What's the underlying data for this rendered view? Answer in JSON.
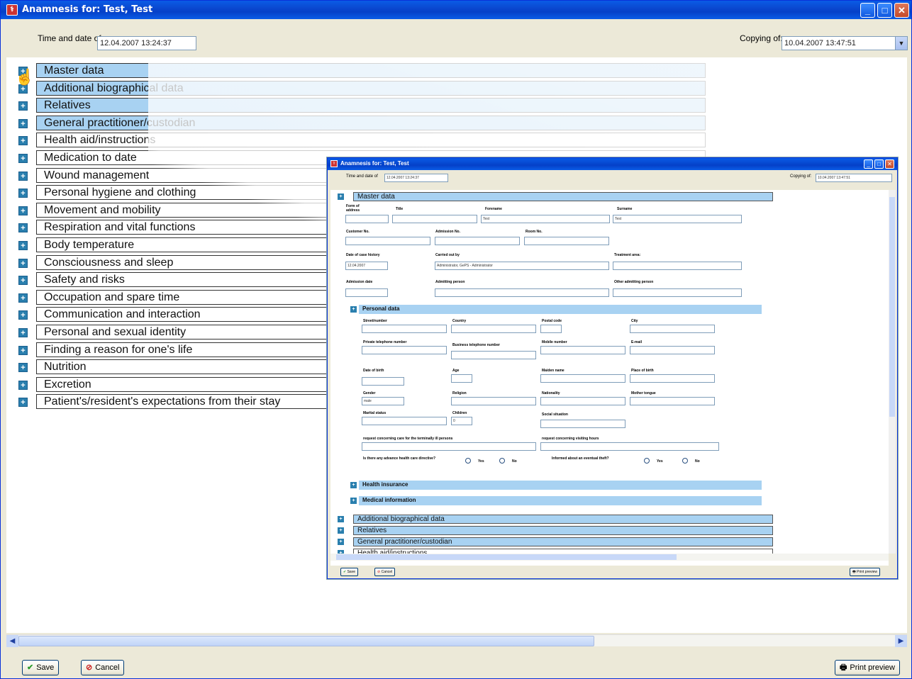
{
  "window": {
    "title": "Anamnesis for: Test, Test"
  },
  "header": {
    "time_label": "Time and date of",
    "time_value": "12.04.2007 13:24:37",
    "copying_label": "Copying of:",
    "copying_value": "10.04.2007 13:47:51"
  },
  "sections": [
    {
      "label": "Master data",
      "highlight": true
    },
    {
      "label": "Additional biographical data",
      "highlight": true
    },
    {
      "label": "Relatives",
      "highlight": true
    },
    {
      "label": "General practitioner/custodian",
      "highlight": true
    },
    {
      "label": "Health aid/instructions",
      "highlight": false
    },
    {
      "label": "Medication to date",
      "highlight": false
    },
    {
      "label": "Wound management",
      "highlight": false
    },
    {
      "label": "Personal hygiene and clothing",
      "highlight": false
    },
    {
      "label": "Movement and mobility",
      "highlight": false
    },
    {
      "label": "Respiration and vital functions",
      "highlight": false
    },
    {
      "label": "Body temperature",
      "highlight": false
    },
    {
      "label": "Consciousness and sleep",
      "highlight": false
    },
    {
      "label": "Safety and risks",
      "highlight": false
    },
    {
      "label": "Occupation and spare time",
      "highlight": false
    },
    {
      "label": "Communication and interaction",
      "highlight": false
    },
    {
      "label": "Personal and sexual identity",
      "highlight": false
    },
    {
      "label": "Finding a reason for one's life",
      "highlight": false
    },
    {
      "label": "Nutrition",
      "highlight": false
    },
    {
      "label": "Excretion",
      "highlight": false
    },
    {
      "label": "Patient's/resident's expectations from their stay",
      "highlight": false
    }
  ],
  "footer": {
    "save": "Save",
    "cancel": "Cancel",
    "print": "Print preview"
  },
  "inner": {
    "title": "Anamnesis for: Test, Test",
    "time_label": "Time and date of",
    "time_value": "12.04.2007 13:24:37",
    "copying_label": "Copying of:",
    "copying_value": "10.04.2007 13:47:51",
    "master": "Master data",
    "labels": {
      "form_of_address": "Form of address",
      "title": "Title",
      "forename": "Forename",
      "surname": "Surname",
      "customer_no": "Customer No.",
      "admission_no": "Admission No.",
      "room_no": "Room No.",
      "date_case": "Date of case history",
      "carried_out": "Carried out by",
      "treatment": "Treatment area:",
      "admission_date": "Admission date",
      "admitting": "Admitting person",
      "other_admitting": "Other admitting person"
    },
    "values": {
      "forename": "Test",
      "surname": "Test",
      "date_case": "12.04.2007",
      "carried_out": "Administrator, GePS - Administrator"
    },
    "personal": "Personal data",
    "plabels": {
      "street": "Street/number",
      "country": "Country",
      "postal": "Postal code",
      "city": "City",
      "private_tel": "Private telephone number",
      "business_tel": "Business telephone number",
      "mobile": "Mobile number",
      "email": "E-mail",
      "dob": "Date of birth",
      "age": "Age",
      "maiden": "Maiden name",
      "pob": "Place of birth",
      "gender": "Gender",
      "religion": "Religion",
      "nationality": "Nationality",
      "mother_tongue": "Mother tongue",
      "marital": "Marital status",
      "children": "Children",
      "social": "Social situation",
      "req_care": "request concerning care for the terminally ill persons",
      "req_visit": "request concerning visiting hours",
      "advance": "Is there any advance health care directive?",
      "informed": "Informed about an eventual theft?",
      "yes": "Yes",
      "no": "No"
    },
    "pvalues": {
      "gender": "male",
      "children": "0"
    },
    "health_ins": "Health insurance",
    "medical": "Medical information",
    "add_bio": "Additional biographical data",
    "relatives": "Relatives",
    "gp": "General practitioner/custodian",
    "health_aid": "Health aid/instructions",
    "save": "Save",
    "cancel": "Cancel",
    "print": "Print preview"
  }
}
